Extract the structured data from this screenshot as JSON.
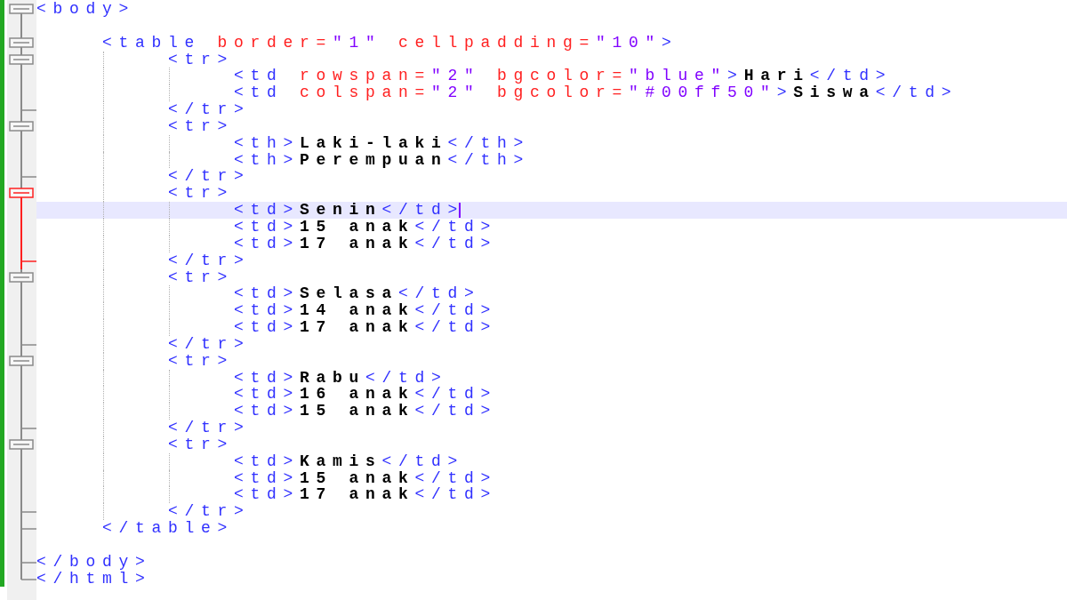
{
  "editor": {
    "lines": [
      {
        "kind": "start",
        "current": false,
        "fold_active": false,
        "caret": false,
        "tokens": [
          {
            "kind": "tag",
            "text": "<body>"
          }
        ]
      },
      {
        "kind": "line",
        "current": false,
        "fold_active": false,
        "caret": false
      },
      {
        "kind": "start",
        "current": false,
        "fold_active": false,
        "caret": false,
        "tokens": [
          {
            "kind": "tag",
            "text": "    <table"
          },
          {
            "kind": "attr",
            "text": " border="
          },
          {
            "kind": "value",
            "text": "\"1\""
          },
          {
            "kind": "attr",
            "text": " cellpadding="
          },
          {
            "kind": "value",
            "text": "\"10\""
          },
          {
            "kind": "tag",
            "text": ">"
          }
        ]
      },
      {
        "kind": "start",
        "current": false,
        "fold_active": false,
        "caret": false,
        "tokens": [
          {
            "kind": "tag",
            "text": "        <tr>"
          }
        ]
      },
      {
        "kind": "line",
        "current": false,
        "fold_active": false,
        "caret": false,
        "tokens": [
          {
            "kind": "tag",
            "text": "            <td"
          },
          {
            "kind": "attr",
            "text": " rowspan="
          },
          {
            "kind": "value",
            "text": "\"2\""
          },
          {
            "kind": "attr",
            "text": " bgcolor="
          },
          {
            "kind": "value",
            "text": "\"blue\""
          },
          {
            "kind": "tag",
            "text": ">"
          },
          {
            "kind": "text",
            "text": "Hari"
          },
          {
            "kind": "tag",
            "text": "</td>"
          }
        ]
      },
      {
        "kind": "line",
        "current": false,
        "fold_active": false,
        "caret": false,
        "tokens": [
          {
            "kind": "tag",
            "text": "            <td"
          },
          {
            "kind": "attr",
            "text": " colspan="
          },
          {
            "kind": "value",
            "text": "\"2\""
          },
          {
            "kind": "attr",
            "text": " bgcolor="
          },
          {
            "kind": "value",
            "text": "\"#00ff50\""
          },
          {
            "kind": "tag",
            "text": ">"
          },
          {
            "kind": "text",
            "text": "Siswa"
          },
          {
            "kind": "tag",
            "text": "</td>"
          }
        ]
      },
      {
        "kind": "end",
        "current": false,
        "fold_active": false,
        "caret": false,
        "tokens": [
          {
            "kind": "tag",
            "text": "        </tr>"
          }
        ]
      },
      {
        "kind": "start",
        "current": false,
        "fold_active": false,
        "caret": false,
        "tokens": [
          {
            "kind": "tag",
            "text": "        <tr>"
          }
        ]
      },
      {
        "kind": "line",
        "current": false,
        "fold_active": false,
        "caret": false,
        "tokens": [
          {
            "kind": "tag",
            "text": "            <th>"
          },
          {
            "kind": "text",
            "text": "Laki-laki"
          },
          {
            "kind": "tag",
            "text": "</th>"
          }
        ]
      },
      {
        "kind": "line",
        "current": false,
        "fold_active": false,
        "caret": false,
        "tokens": [
          {
            "kind": "tag",
            "text": "            <th>"
          },
          {
            "kind": "text",
            "text": "Perempuan"
          },
          {
            "kind": "tag",
            "text": "</th>"
          }
        ]
      },
      {
        "kind": "end",
        "current": false,
        "fold_active": false,
        "caret": false,
        "tokens": [
          {
            "kind": "tag",
            "text": "        </tr>"
          }
        ]
      },
      {
        "kind": "start",
        "current": false,
        "fold_active": true,
        "caret": false,
        "tokens": [
          {
            "kind": "tag",
            "text": "        <tr>"
          }
        ]
      },
      {
        "kind": "line",
        "current": true,
        "fold_active": true,
        "caret": true,
        "tokens": [
          {
            "kind": "tag",
            "text": "            <td>"
          },
          {
            "kind": "text",
            "text": "Senin"
          },
          {
            "kind": "tag",
            "text": "</td>"
          }
        ]
      },
      {
        "kind": "line",
        "current": false,
        "fold_active": true,
        "caret": false,
        "tokens": [
          {
            "kind": "tag",
            "text": "            <td>"
          },
          {
            "kind": "text",
            "text": "15 anak"
          },
          {
            "kind": "tag",
            "text": "</td>"
          }
        ]
      },
      {
        "kind": "line",
        "current": false,
        "fold_active": true,
        "caret": false,
        "tokens": [
          {
            "kind": "tag",
            "text": "            <td>"
          },
          {
            "kind": "text",
            "text": "17 anak"
          },
          {
            "kind": "tag",
            "text": "</td>"
          }
        ]
      },
      {
        "kind": "end",
        "current": false,
        "fold_active": true,
        "caret": false,
        "tokens": [
          {
            "kind": "tag",
            "text": "        </tr>"
          }
        ]
      },
      {
        "kind": "start",
        "current": false,
        "fold_active": false,
        "caret": false,
        "tokens": [
          {
            "kind": "tag",
            "text": "        <tr>"
          }
        ]
      },
      {
        "kind": "line",
        "current": false,
        "fold_active": false,
        "caret": false,
        "tokens": [
          {
            "kind": "tag",
            "text": "            <td>"
          },
          {
            "kind": "text",
            "text": "Selasa"
          },
          {
            "kind": "tag",
            "text": "</td>"
          }
        ]
      },
      {
        "kind": "line",
        "current": false,
        "fold_active": false,
        "caret": false,
        "tokens": [
          {
            "kind": "tag",
            "text": "            <td>"
          },
          {
            "kind": "text",
            "text": "14 anak"
          },
          {
            "kind": "tag",
            "text": "</td>"
          }
        ]
      },
      {
        "kind": "line",
        "current": false,
        "fold_active": false,
        "caret": false,
        "tokens": [
          {
            "kind": "tag",
            "text": "            <td>"
          },
          {
            "kind": "text",
            "text": "17 anak"
          },
          {
            "kind": "tag",
            "text": "</td>"
          }
        ]
      },
      {
        "kind": "end",
        "current": false,
        "fold_active": false,
        "caret": false,
        "tokens": [
          {
            "kind": "tag",
            "text": "        </tr>"
          }
        ]
      },
      {
        "kind": "start",
        "current": false,
        "fold_active": false,
        "caret": false,
        "tokens": [
          {
            "kind": "tag",
            "text": "        <tr>"
          }
        ]
      },
      {
        "kind": "line",
        "current": false,
        "fold_active": false,
        "caret": false,
        "tokens": [
          {
            "kind": "tag",
            "text": "            <td>"
          },
          {
            "kind": "text",
            "text": "Rabu"
          },
          {
            "kind": "tag",
            "text": "</td>"
          }
        ]
      },
      {
        "kind": "line",
        "current": false,
        "fold_active": false,
        "caret": false,
        "tokens": [
          {
            "kind": "tag",
            "text": "            <td>"
          },
          {
            "kind": "text",
            "text": "16 anak"
          },
          {
            "kind": "tag",
            "text": "</td>"
          }
        ]
      },
      {
        "kind": "line",
        "current": false,
        "fold_active": false,
        "caret": false,
        "tokens": [
          {
            "kind": "tag",
            "text": "            <td>"
          },
          {
            "kind": "text",
            "text": "15 anak"
          },
          {
            "kind": "tag",
            "text": "</td>"
          }
        ]
      },
      {
        "kind": "end",
        "current": false,
        "fold_active": false,
        "caret": false,
        "tokens": [
          {
            "kind": "tag",
            "text": "        </tr>"
          }
        ]
      },
      {
        "kind": "start",
        "current": false,
        "fold_active": false,
        "caret": false,
        "tokens": [
          {
            "kind": "tag",
            "text": "        <tr>"
          }
        ]
      },
      {
        "kind": "line",
        "current": false,
        "fold_active": false,
        "caret": false,
        "tokens": [
          {
            "kind": "tag",
            "text": "            <td>"
          },
          {
            "kind": "text",
            "text": "Kamis"
          },
          {
            "kind": "tag",
            "text": "</td>"
          }
        ]
      },
      {
        "kind": "line",
        "current": false,
        "fold_active": false,
        "caret": false,
        "tokens": [
          {
            "kind": "tag",
            "text": "            <td>"
          },
          {
            "kind": "text",
            "text": "15 anak"
          },
          {
            "kind": "tag",
            "text": "</td>"
          }
        ]
      },
      {
        "kind": "line",
        "current": false,
        "fold_active": false,
        "caret": false,
        "tokens": [
          {
            "kind": "tag",
            "text": "            <td>"
          },
          {
            "kind": "text",
            "text": "17 anak"
          },
          {
            "kind": "tag",
            "text": "</td>"
          }
        ]
      },
      {
        "kind": "end",
        "current": false,
        "fold_active": false,
        "caret": false,
        "tokens": [
          {
            "kind": "tag",
            "text": "        </tr>"
          }
        ]
      },
      {
        "kind": "end",
        "current": false,
        "fold_active": false,
        "caret": false,
        "tokens": [
          {
            "kind": "tag",
            "text": "    </table>"
          }
        ]
      },
      {
        "kind": "line",
        "current": false,
        "fold_active": false,
        "caret": false
      },
      {
        "kind": "end",
        "current": false,
        "fold_active": false,
        "caret": false,
        "tokens": [
          {
            "kind": "tag",
            "text": "</body>"
          }
        ]
      },
      {
        "kind": "end",
        "current": false,
        "fold_active": false,
        "caret": false,
        "tokens": [
          {
            "kind": "tag",
            "text": "</html>"
          }
        ]
      }
    ]
  }
}
